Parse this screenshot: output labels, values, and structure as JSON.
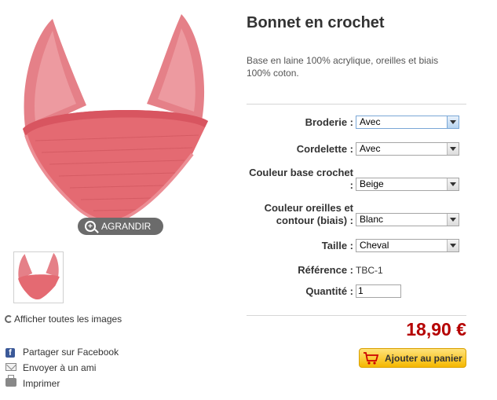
{
  "product": {
    "title": "Bonnet en crochet",
    "description": "Base en laine 100% acrylique, oreilles et biais 100% coton.",
    "color": "#e46a72"
  },
  "gallery": {
    "enlarge_label": "AGRANDIR",
    "show_all_label": "Afficher toutes les images"
  },
  "share": {
    "facebook_label": "Partager sur Facebook",
    "email_label": "Envoyer à un ami",
    "print_label": "Imprimer"
  },
  "options": {
    "broderie": {
      "label": "Broderie :",
      "value": "Avec"
    },
    "cordelette": {
      "label": "Cordelette :",
      "value": "Avec"
    },
    "couleur_base": {
      "label_line1": "Couleur base crochet",
      "label_line2": ":",
      "value": "Beige"
    },
    "couleur_oreilles": {
      "label_line1": "Couleur oreilles et",
      "label_line2": "contour (biais) :",
      "value": "Blanc"
    },
    "taille": {
      "label": "Taille :",
      "value": "Cheval"
    }
  },
  "reference": {
    "label": "Référence :",
    "value": "TBC-1"
  },
  "quantity": {
    "label": "Quantité :",
    "value": "1"
  },
  "price": "18,90 €",
  "cart": {
    "label": "Ajouter au panier"
  },
  "colors": {
    "price": "#b50000",
    "button": "#f5b800",
    "facebook": "#3b5998"
  }
}
